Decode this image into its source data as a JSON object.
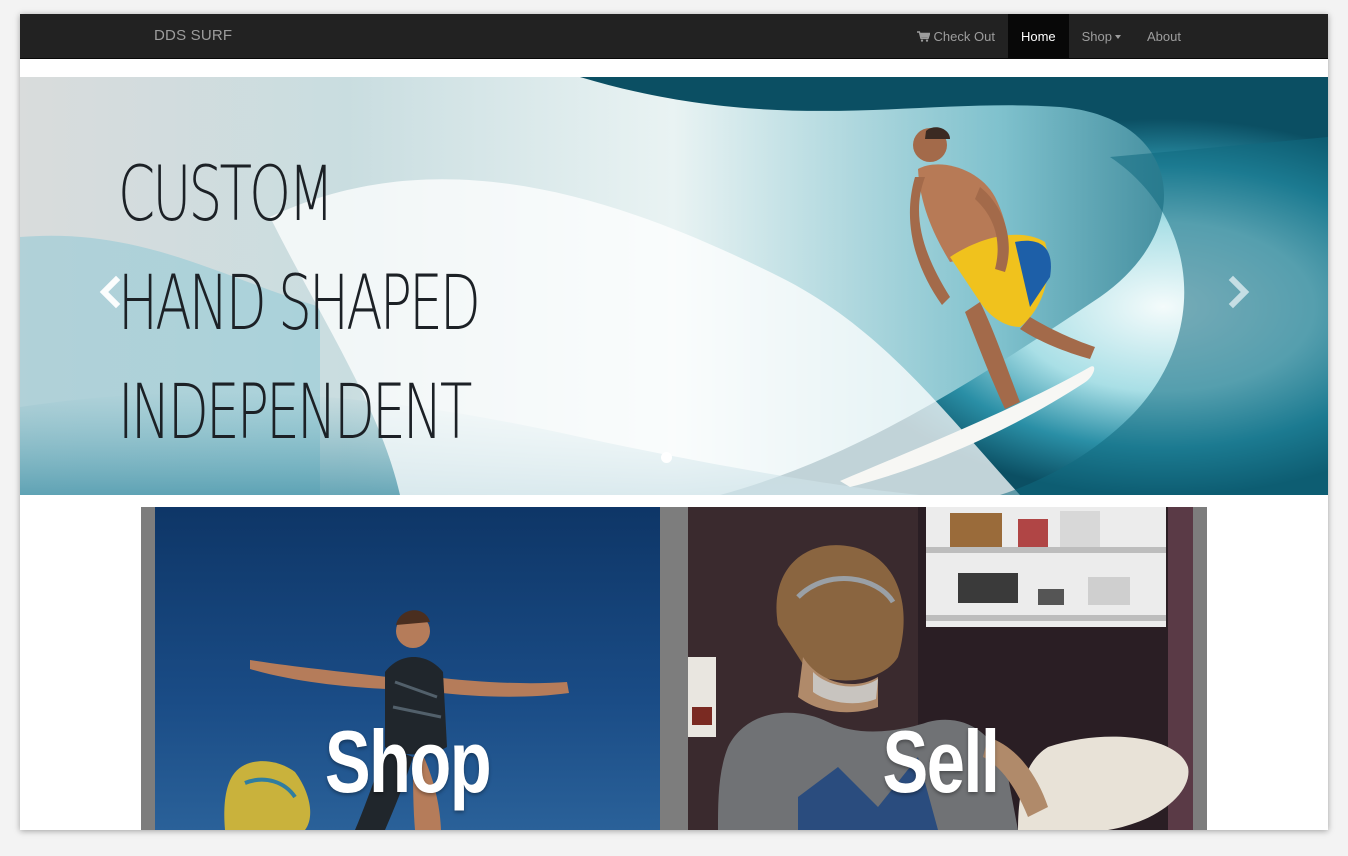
{
  "navbar": {
    "brand": "DDS SURF",
    "items": [
      {
        "label": "Check Out",
        "icon": "cart-icon"
      },
      {
        "label": "Home",
        "active": true
      },
      {
        "label": "Shop",
        "icon": "caret-down-icon"
      },
      {
        "label": "About"
      }
    ]
  },
  "carousel": {
    "headline": [
      "CUSTOM",
      "HAND SHAPED",
      "INDEPENDENT"
    ],
    "prev_icon": "chevron-left-icon",
    "next_icon": "chevron-right-icon",
    "slide_count_indicators": 1
  },
  "tiles": [
    {
      "label": "Shop"
    },
    {
      "label": "Sell"
    }
  ],
  "colors": {
    "navbar_bg": "#222222",
    "nav_text": "#9d9d9d",
    "nav_active_bg": "#080808",
    "headline": "#1c2126",
    "tile_gap": "#7d7d7d"
  }
}
